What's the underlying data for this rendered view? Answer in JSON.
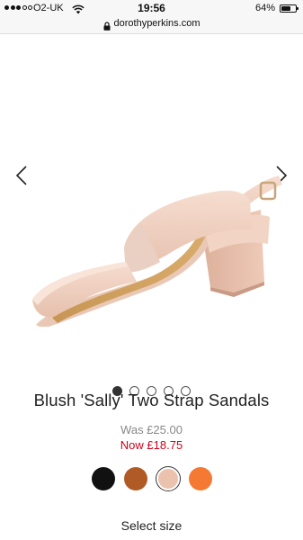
{
  "status_bar": {
    "carrier": "O2-UK",
    "time": "19:56",
    "battery_percent": "64%",
    "battery_level": 0.64,
    "signal_bars": 3,
    "signal_total": 5
  },
  "browser": {
    "url": "dorothyperkins.com"
  },
  "carousel": {
    "image_subject": "blush two strap block heel sandal",
    "slide_count": 5,
    "active_slide": 1,
    "prev_icon": "chevron-left-icon",
    "next_icon": "chevron-right-icon"
  },
  "product": {
    "title": "Blush 'Sally' Two Strap Sandals",
    "price_was": "Was £25.00",
    "price_now": "Now £18.75",
    "colors": [
      {
        "name": "black",
        "hex": "#111111",
        "selected": false
      },
      {
        "name": "tan",
        "hex": "#b05a26",
        "selected": false
      },
      {
        "name": "blush",
        "hex": "#ebc2ad",
        "selected": true
      },
      {
        "name": "orange",
        "hex": "#f47a33",
        "selected": false
      }
    ],
    "select_size_label": "Select size"
  },
  "theme": {
    "sale_price_color": "#d0021b",
    "was_price_color": "#888888"
  }
}
